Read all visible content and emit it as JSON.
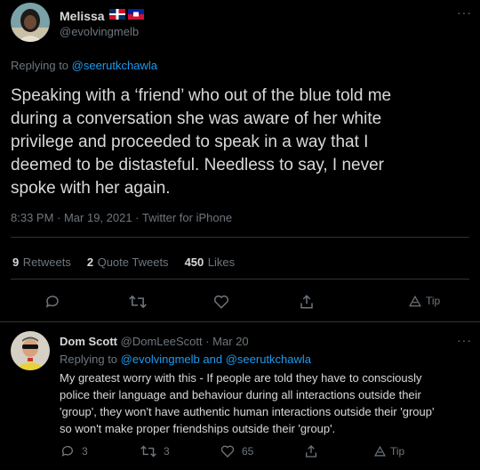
{
  "main_tweet": {
    "author": {
      "name": "Melissa",
      "handle": "@evolvingmelb",
      "flags": [
        "dominican-republic-flag",
        "haiti-flag"
      ]
    },
    "replying_prefix": "Replying to",
    "replying_to": "@seerutkchawla",
    "text": "Speaking with a ‘friend’ who out of the blue told me during a conversation she was aware of her white privilege and proceeded to speak in a way that I deemed to be distasteful. Needless to say, I never spoke with her again.",
    "text_lines": [
      "Speaking with a ‘friend’ who out of the blue told me",
      "during a conversation she was aware of her white",
      "privilege and proceeded to speak in a way that I",
      "deemed to be distasteful. Needless to say, I never",
      "spoke with her again."
    ],
    "timestamp": "8:33 PM · Mar 19, 2021 · Twitter for iPhone",
    "stats": {
      "retweets_count": "9",
      "retweets_label": "Retweets",
      "quotes_count": "2",
      "quotes_label": "Quote Tweets",
      "likes_count": "450",
      "likes_label": "Likes"
    },
    "actions": {
      "tip_label": "Tip"
    }
  },
  "reply_tweet": {
    "author": {
      "name": "Dom Scott",
      "handle": "@DomLeeScott",
      "date": "· Mar 20"
    },
    "replying_prefix": "Replying to",
    "replying_to_1": "@evolvingmelb",
    "replying_and": "and",
    "replying_to_2": "@seerutkchawla",
    "text_lines": [
      "My greatest worry with this - If people are told they have to consciously",
      "police their language and behaviour during all interactions outside their",
      "'group', they won't have authentic human interactions outside their 'group'",
      "so won't make proper friendships outside their 'group'."
    ],
    "actions": {
      "replies": "3",
      "retweets": "3",
      "likes": "65",
      "tip_label": "Tip"
    }
  },
  "colors": {
    "background": "#000000",
    "text": "#d9d9d9",
    "muted": "#6e767d",
    "link": "#1d9bf0",
    "divider": "#2f3336"
  },
  "more_glyph": "···"
}
